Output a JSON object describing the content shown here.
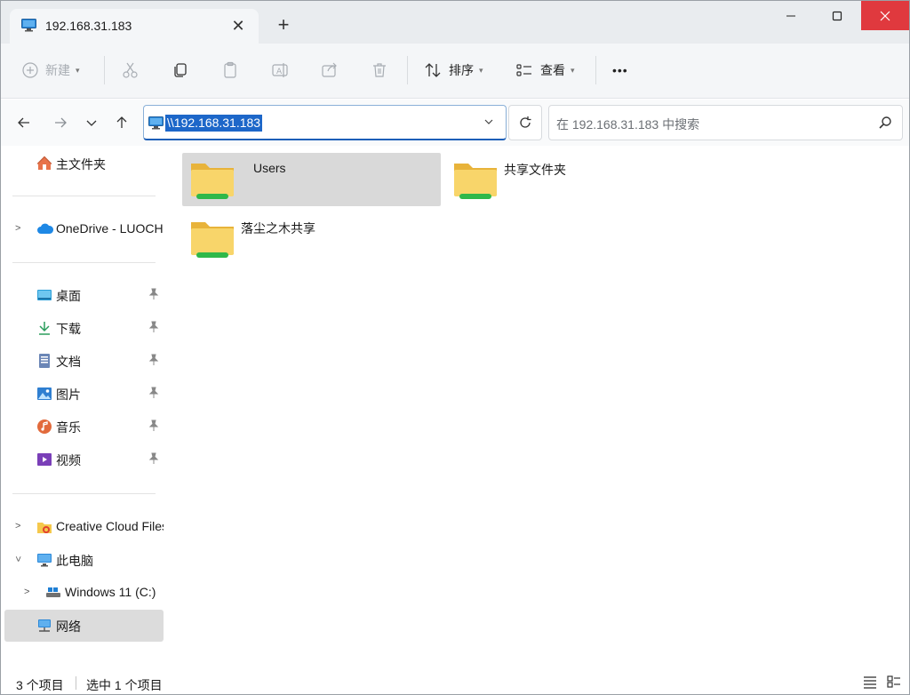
{
  "tab": {
    "title": "192.168.31.183",
    "close": "✕",
    "new_tab": "+"
  },
  "window": {
    "minimize": "minimize",
    "maximize": "maximize",
    "close": "close"
  },
  "toolbar": {
    "new_label": "新建",
    "sort_label": "排序",
    "view_label": "查看",
    "more_label": "•••",
    "caret": "⌄"
  },
  "address": {
    "path": "\\\\192.168.31.183",
    "search_placeholder": "在 192.168.31.183 中搜索"
  },
  "sidebar": {
    "home": "主文件夹",
    "onedrive": "OneDrive - LUOCHEN",
    "quick": [
      {
        "label": "桌面",
        "icon": "desktop-icon"
      },
      {
        "label": "下载",
        "icon": "download-icon"
      },
      {
        "label": "文档",
        "icon": "document-icon"
      },
      {
        "label": "图片",
        "icon": "pictures-icon"
      },
      {
        "label": "音乐",
        "icon": "music-icon"
      },
      {
        "label": "视频",
        "icon": "video-icon"
      }
    ],
    "creative_cloud": "Creative Cloud Files",
    "this_pc": "此电脑",
    "windows_drive": "Windows 11 (C:)",
    "network": "网络"
  },
  "content": {
    "folders": [
      {
        "name": "Users",
        "selected": true
      },
      {
        "name": "共享文件夹",
        "selected": false
      },
      {
        "name": "落尘之木共享",
        "selected": false
      }
    ]
  },
  "status": {
    "count": "3 个项目",
    "selected": "选中 1 个项目"
  },
  "colors": {
    "accent": "#1d67c9",
    "close_red": "#e0393e",
    "folder_yellow": "#f5c84c",
    "network_green": "#2fb84a"
  }
}
